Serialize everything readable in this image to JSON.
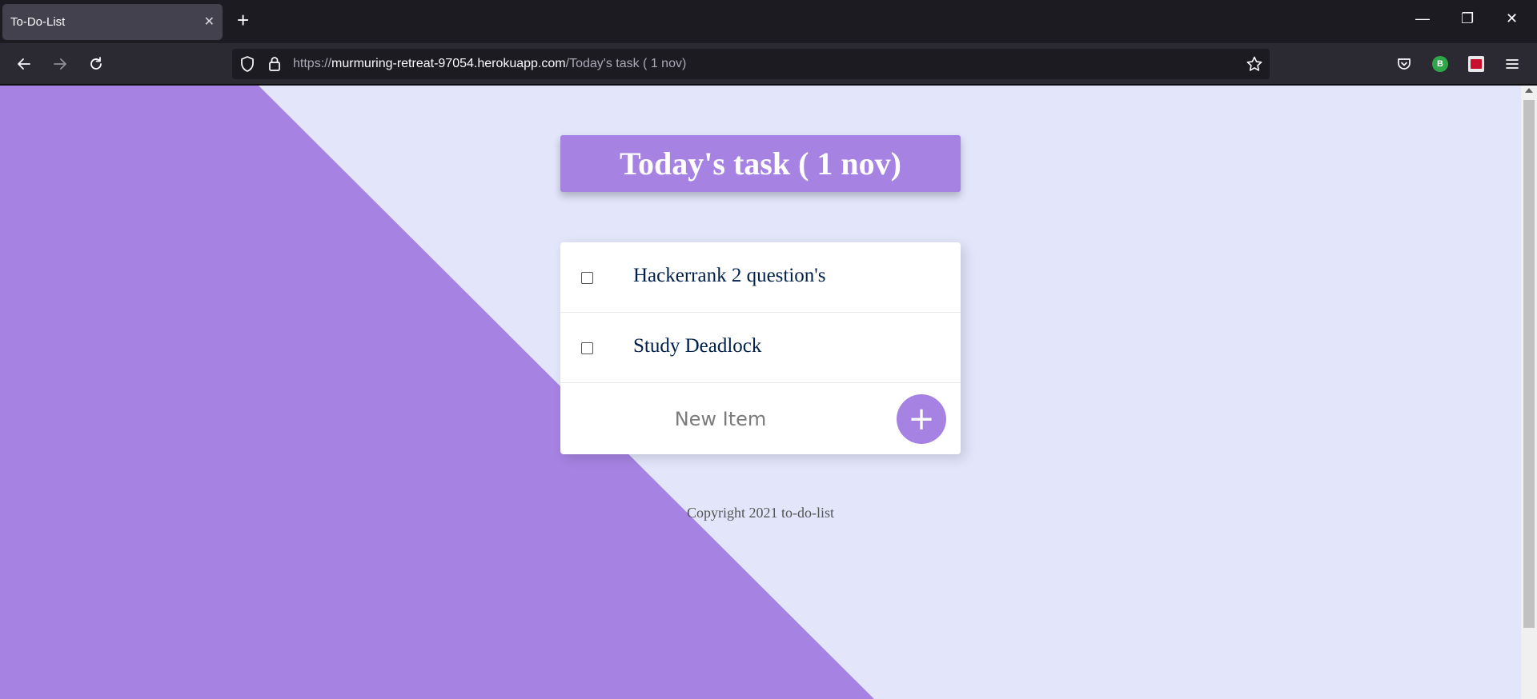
{
  "browser": {
    "tab_title": "To-Do-List",
    "tab_close_glyph": "✕",
    "new_tab_glyph": "+",
    "url_scheme": "https://",
    "url_host": "murmuring-retreat-97054.herokuapp.com",
    "url_path": "/Today's task ( 1 nov)",
    "profile_initial": "B",
    "window_minimize_glyph": "—",
    "window_restore_glyph": "❐",
    "window_close_glyph": "✕"
  },
  "page": {
    "heading": "Today's task ( 1 nov)",
    "items": [
      {
        "text": "Hackerrank 2 question's",
        "checked": false
      },
      {
        "text": "Study Deadlock",
        "checked": false
      }
    ],
    "new_item_placeholder": "New Item",
    "add_button_label": "+",
    "footer": "Copyright 2021 to-do-list"
  },
  "colors": {
    "accent_purple": "#a683e3",
    "page_background": "#e3e6fb",
    "item_text": "#00204a"
  }
}
